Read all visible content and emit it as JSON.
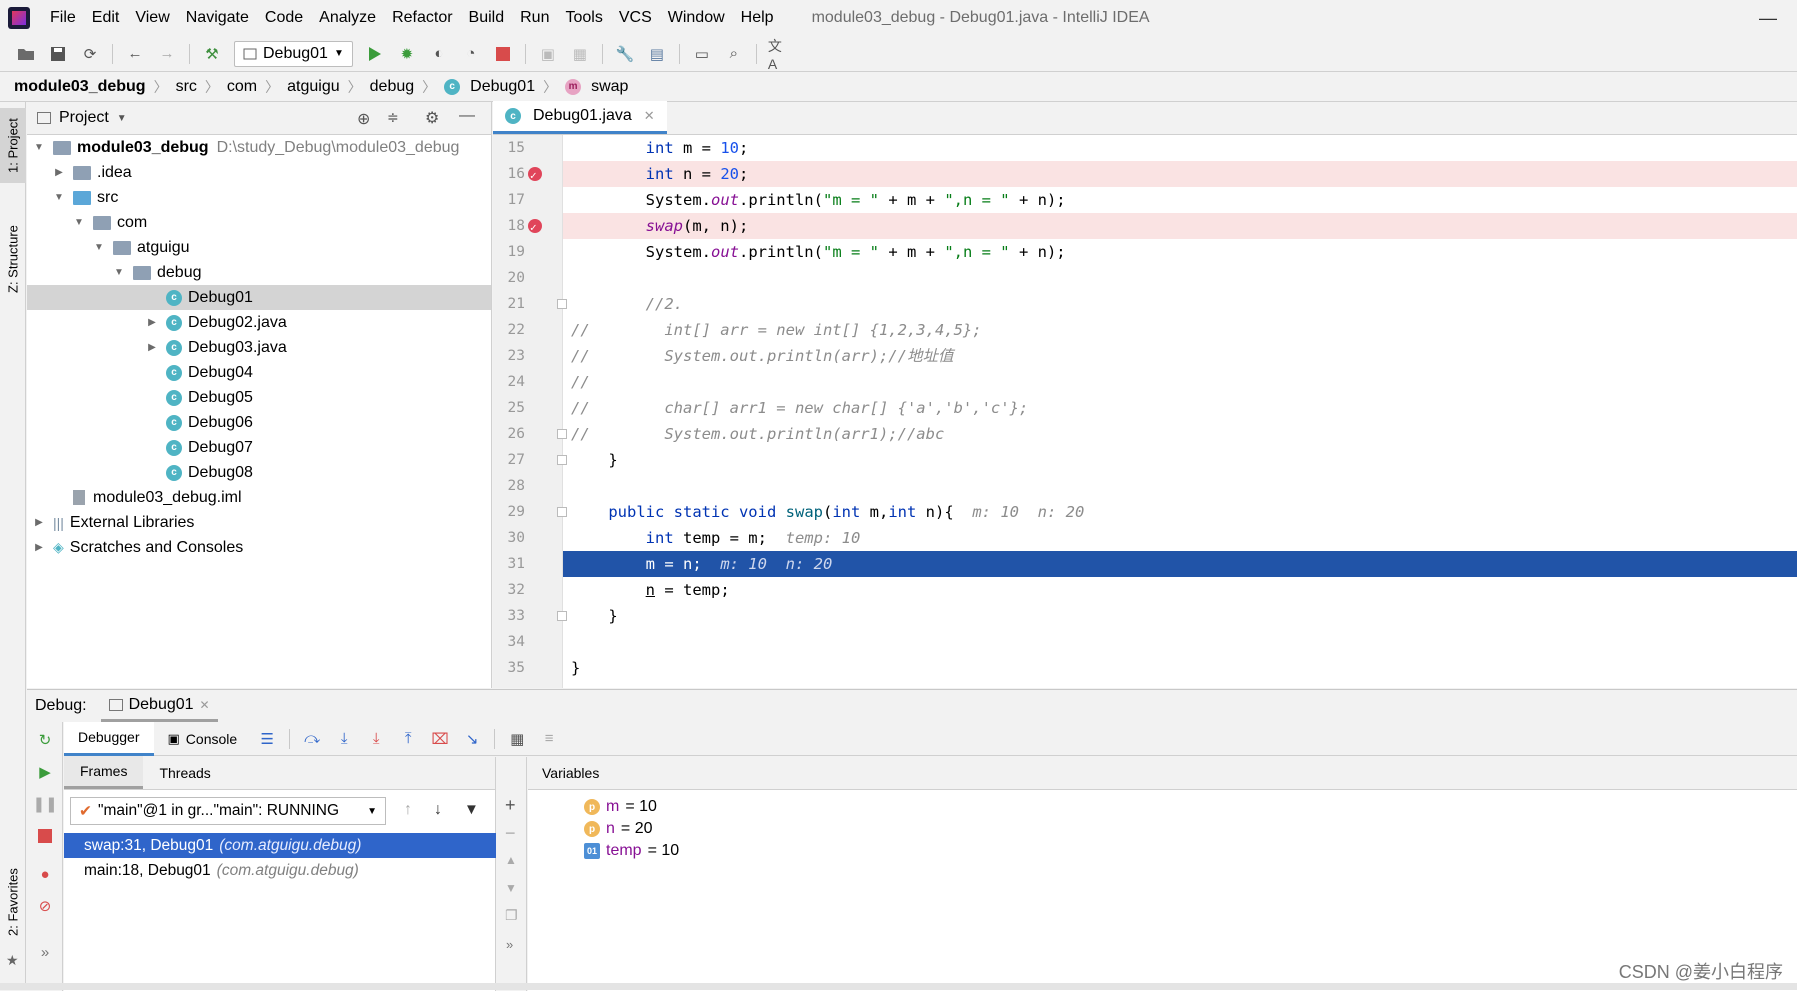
{
  "window": {
    "title": "module03_debug - Debug01.java - IntelliJ IDEA",
    "minimize": "—"
  },
  "menu": [
    "File",
    "Edit",
    "View",
    "Navigate",
    "Code",
    "Analyze",
    "Refactor",
    "Build",
    "Run",
    "Tools",
    "VCS",
    "Window",
    "Help"
  ],
  "toolbar": {
    "run_config": "Debug01"
  },
  "breadcrumb": [
    "module03_debug",
    "src",
    "com",
    "atguigu",
    "debug",
    "Debug01",
    "swap"
  ],
  "left_stripe": {
    "project": "1: Project",
    "structure": "Z: Structure",
    "favorites": "2: Favorites"
  },
  "project": {
    "header": "Project",
    "root": {
      "name": "module03_debug",
      "path": "D:\\study_Debug\\module03_debug"
    },
    "items": [
      ".idea",
      "src",
      "com",
      "atguigu",
      "debug",
      "Debug01",
      "Debug02.java",
      "Debug03.java",
      "Debug04",
      "Debug05",
      "Debug06",
      "Debug07",
      "Debug08",
      "module03_debug.iml",
      "External Libraries",
      "Scratches and Consoles"
    ]
  },
  "editor": {
    "tab": "Debug01.java",
    "lines": [
      {
        "n": "15"
      },
      {
        "n": "16"
      },
      {
        "n": "17"
      },
      {
        "n": "18"
      },
      {
        "n": "19"
      },
      {
        "n": "20"
      },
      {
        "n": "21"
      },
      {
        "n": "22"
      },
      {
        "n": "23"
      },
      {
        "n": "24"
      },
      {
        "n": "25"
      },
      {
        "n": "26"
      },
      {
        "n": "27"
      },
      {
        "n": "28"
      },
      {
        "n": "29"
      },
      {
        "n": "30"
      },
      {
        "n": "31"
      },
      {
        "n": "32"
      },
      {
        "n": "33"
      },
      {
        "n": "34"
      },
      {
        "n": "35"
      }
    ]
  },
  "debug": {
    "label": "Debug:",
    "session": "Debug01",
    "tabs": {
      "debugger": "Debugger",
      "console": "Console"
    },
    "frames_tabs": {
      "frames": "Frames",
      "threads": "Threads"
    },
    "thread": "\"main\"@1 in gr...\"main\": RUNNING",
    "frames": [
      {
        "method": "swap:31, Debug01",
        "pkg": "(com.atguigu.debug)"
      },
      {
        "method": "main:18, Debug01",
        "pkg": "(com.atguigu.debug)"
      }
    ],
    "variables_header": "Variables",
    "variables": [
      {
        "icon": "p",
        "name": "m",
        "value": "= 10"
      },
      {
        "icon": "p",
        "name": "n",
        "value": "= 20"
      },
      {
        "icon": "01",
        "name": "temp",
        "value": "= 10"
      }
    ]
  },
  "watermark": "CSDN @姜小白程序"
}
